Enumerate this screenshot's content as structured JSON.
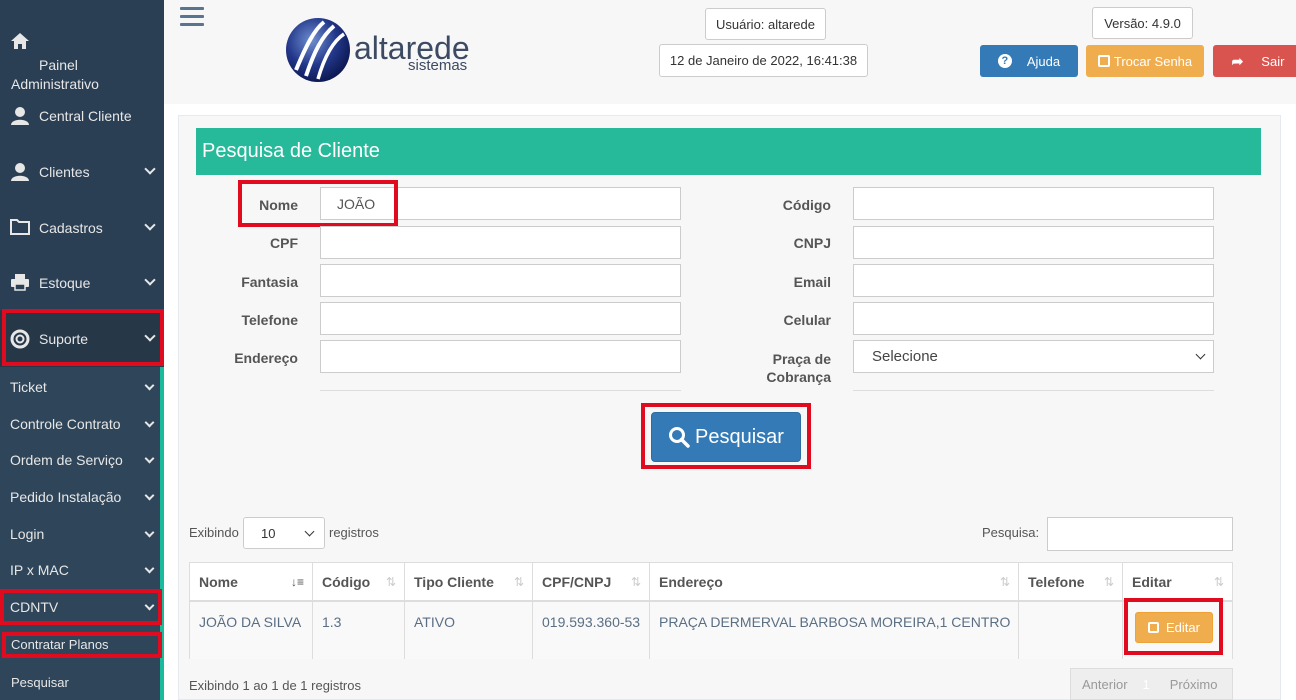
{
  "sidebar": {
    "main": [
      {
        "label": "Painel Administrativo",
        "icon": "home-icon"
      },
      {
        "label": "Central Cliente",
        "icon": "user-icon"
      },
      {
        "label": "Clientes",
        "icon": "user-icon"
      },
      {
        "label": "Cadastros",
        "icon": "folder-icon"
      },
      {
        "label": "Estoque",
        "icon": "print-icon"
      },
      {
        "label": "Suporte",
        "icon": "life-ring-icon"
      }
    ],
    "sub": [
      "Ticket",
      "Controle Contrato",
      "Ordem de Serviço",
      "Pedido Instalação",
      "Login",
      "IP x MAC",
      "CDNTV",
      "Contratar Planos",
      "Pesquisar"
    ]
  },
  "header": {
    "logo_main": "altarede",
    "logo_sub": "sistemas",
    "user": "Usuário: altarede",
    "datetime": "12 de Janeiro de 2022, 16:41:38",
    "version": "Versão: 4.9.0",
    "help": "Ajuda",
    "change_password": "Trocar Senha",
    "exit": "Sair"
  },
  "search": {
    "title": "Pesquisa de Cliente",
    "labels": {
      "nome": "Nome",
      "cpf": "CPF",
      "fantasia": "Fantasia",
      "telefone": "Telefone",
      "endereco": "Endereço",
      "codigo": "Código",
      "cnpj": "CNPJ",
      "email": "Email",
      "celular": "Celular",
      "praca_1": "Praça de",
      "praca_2": "Cobrança"
    },
    "values": {
      "nome": "JOÃO"
    },
    "praca_selected": "Selecione",
    "button": "Pesquisar"
  },
  "results": {
    "showing_prefix": "Exibindo",
    "page_length": "10",
    "showing_suffix": "registros",
    "search_label": "Pesquisa:",
    "columns": [
      "Nome",
      "Código",
      "Tipo Cliente",
      "CPF/CNPJ",
      "Endereço",
      "Telefone",
      "Editar"
    ],
    "rows": [
      {
        "nome": "JOÃO DA SILVA",
        "codigo": "1.3",
        "tipo": "ATIVO",
        "cpf": "019.593.360-53",
        "endereco": "PRAÇA DERMERVAL BARBOSA MOREIRA,1 CENTRO",
        "telefone": "",
        "edit": "Editar"
      }
    ],
    "info": "Exibindo 1 ao 1 de 1 registros",
    "prev": "Anterior",
    "page": "1",
    "next": "Próximo"
  },
  "colors": {
    "sidebar": "#2a3f54",
    "accent": "#26b99a",
    "primary": "#337ab7",
    "warning": "#f0ad4e",
    "danger": "#d9534f",
    "highlight": "#e00b1f"
  }
}
